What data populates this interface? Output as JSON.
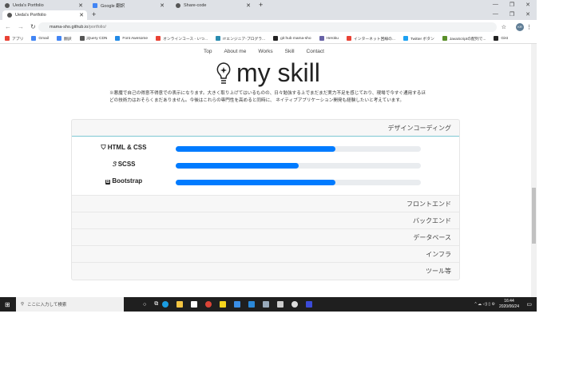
{
  "browser": {
    "tabs": [
      {
        "label": "Ueda's Portfolio"
      },
      {
        "label": "Google 翻訳"
      },
      {
        "label": "Share-code"
      }
    ],
    "active_tab": {
      "label": "Ueda's Portfolio"
    },
    "url_host": "mama-sho.github.io",
    "url_path": "/portfolio/",
    "bookmarks": [
      {
        "label": "アプリ",
        "color": "#e94235"
      },
      {
        "label": "Gmail",
        "color": "#4285f4"
      },
      {
        "label": "翻訳",
        "color": "#4285f4"
      },
      {
        "label": "jQuery CDN",
        "color": "#555"
      },
      {
        "label": "Font Awesome",
        "color": "#228ae6"
      },
      {
        "label": "オンラインコース - いつ...",
        "color": "#e94235"
      },
      {
        "label": "ITエンジニア-プログラ...",
        "color": "#2a8cb0"
      },
      {
        "label": "git hub mama-sho",
        "color": "#222"
      },
      {
        "label": "Heroku",
        "color": "#6762a6"
      },
      {
        "label": "インターネット回線の...",
        "color": "#e94235"
      },
      {
        "label": "Twitter ボタン",
        "color": "#1da1f2"
      },
      {
        "label": "JavaScriptの配列で...",
        "color": "#5a8f29"
      },
      {
        "label": "Gist",
        "color": "#222"
      }
    ],
    "avatar": "KR"
  },
  "page": {
    "menu": [
      "Top",
      "About me",
      "Works",
      "Skill",
      "Contact"
    ],
    "title": "my skill",
    "note": "※悪魔で自己の得意不得意での表示になります。大きく取り上げてはいるものの、日々勉強する上でまだまだ実力不足を感じており、現場で今すぐ通用するほどの技術力はおそらくまだありません。今後はこれらの専門性を高めると同時に、 ネイティブアプリケーション開発も経験したいと考えています。",
    "sections": [
      "デザインコーディング",
      "フロントエンド",
      "バックエンド",
      "データベース",
      "インフラ",
      "ツール等"
    ],
    "skills": [
      {
        "label": "HTML & CSS",
        "icon": "html5-icon",
        "progress": 65
      },
      {
        "label": "SCSS",
        "icon": "sass-icon",
        "progress": 50
      },
      {
        "label": "Bootstrap",
        "icon": "bootstrap-icon",
        "progress": 65
      }
    ],
    "accent": "#007bff"
  },
  "taskbar": {
    "search": "ここに入力して検索",
    "time": "16:44",
    "date": "2020/06/24"
  }
}
